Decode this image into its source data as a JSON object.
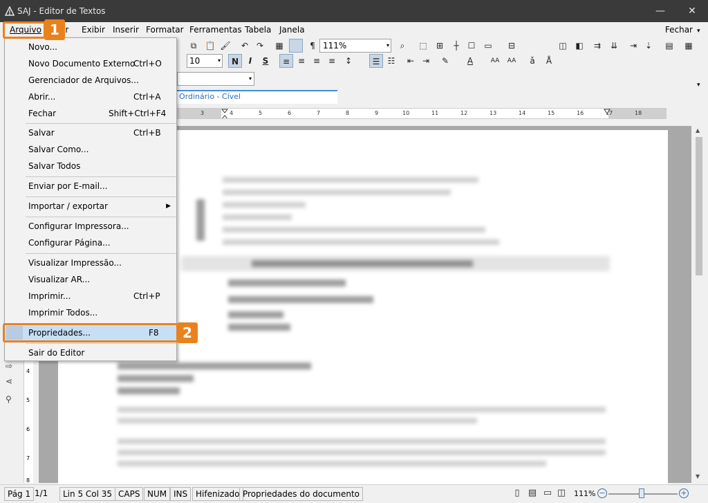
{
  "window": {
    "title": "SAJ - Editor de Textos",
    "min": "—",
    "max": "☐",
    "close": "✕"
  },
  "menubar": {
    "items": [
      "Arquivo",
      "Editar",
      "Exibir",
      "Inserir",
      "Formatar",
      "Ferramentas",
      "Tabela",
      "Janela"
    ],
    "visible_labels": [
      "Arquivo",
      "ar",
      "Exibir",
      "Inserir",
      "Formatar",
      "Ferramentas",
      "Tabela",
      "Janela"
    ],
    "right_label": "Fechar",
    "right_arrow": "▾"
  },
  "toolbar": {
    "zoom_value": "111%",
    "font_size": "10",
    "bold": "N",
    "italic": "I",
    "strike": "S",
    "pilcrow": "¶",
    "arrow": "▾"
  },
  "document_tab": {
    "label": "Ordinário - Cível"
  },
  "ruler_ticks": [
    "3",
    "4",
    "5",
    "6",
    "7",
    "8",
    "9",
    "10",
    "11",
    "12",
    "13",
    "14",
    "15",
    "16",
    "17",
    "18"
  ],
  "vruler_ticks": [
    "4",
    "5",
    "6",
    "7",
    "8"
  ],
  "file_menu": {
    "items": [
      {
        "label": "Novo...",
        "shortcut": ""
      },
      {
        "label": "Novo Documento Externo",
        "shortcut": "Ctrl+O"
      },
      {
        "label": "Gerenciador de Arquivos...",
        "shortcut": ""
      },
      {
        "label": "Abrir...",
        "shortcut": "Ctrl+A"
      },
      {
        "label": "Fechar",
        "shortcut": "Shift+Ctrl+F4"
      },
      {
        "label": "Salvar",
        "shortcut": "Ctrl+B"
      },
      {
        "label": "Salvar Como...",
        "shortcut": ""
      },
      {
        "label": "Salvar Todos",
        "shortcut": ""
      },
      {
        "label": "Enviar por E-mail...",
        "shortcut": ""
      },
      {
        "label": "Importar / exportar",
        "shortcut": "",
        "submenu_arrow": "▶"
      },
      {
        "label": "Configurar Impressora...",
        "shortcut": ""
      },
      {
        "label": "Configurar Página...",
        "shortcut": ""
      },
      {
        "label": "Visualizar Impressão...",
        "shortcut": ""
      },
      {
        "label": "Visualizar AR...",
        "shortcut": ""
      },
      {
        "label": "Imprimir...",
        "shortcut": "Ctrl+P"
      },
      {
        "label": "Imprimir Todos...",
        "shortcut": ""
      },
      {
        "label": "Propriedades...",
        "shortcut": "F8"
      },
      {
        "label": "Sair do Editor",
        "shortcut": ""
      }
    ]
  },
  "callouts": {
    "one": "1",
    "two": "2"
  },
  "statusbar": {
    "page": "Pág 1",
    "pages": "1/1",
    "position": "Lin 5  Col 35",
    "caps": "CAPS",
    "num": "NUM",
    "ins": "INS",
    "hyphen": "Hifenizado",
    "message": "Propriedades do documento",
    "zoom": "111%",
    "zoom_fraction": 0.5,
    "minus": "−",
    "plus": "+"
  },
  "colors": {
    "accent": "#e9821e",
    "highlight": "#c6dff5",
    "titlebar": "#3a3a3a",
    "tab_blue": "#3d8ee0"
  },
  "icons": [
    "app-logo-icon",
    "search-icon",
    "undo-icon",
    "redo-icon",
    "pilcrow-icon",
    "format-painter-icon"
  ]
}
